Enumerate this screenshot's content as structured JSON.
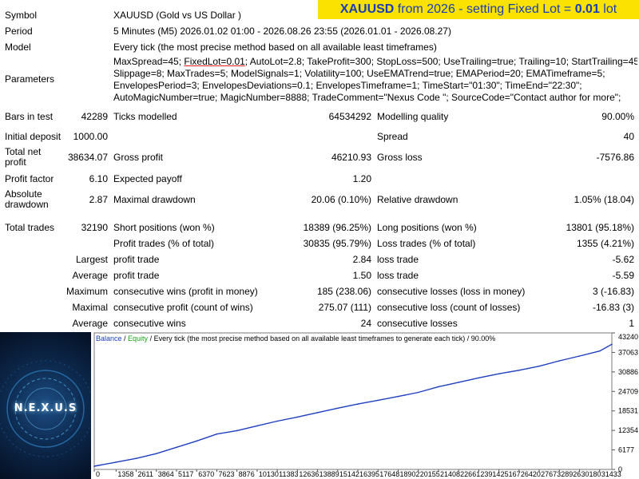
{
  "banner": {
    "symbol": "XAUUSD",
    "middle": "from 2026 - setting Fixed Lot =",
    "lot": "0.01",
    "unit": "lot"
  },
  "header_rows": [
    {
      "label": "Symbol",
      "value": "XAUUSD (Gold vs US Dollar )"
    },
    {
      "label": "Period",
      "value": "5 Minutes (M5) 2026.01.02 01:00 - 2026.08.26 23:55 (2026.01.01 - 2026.08.27)"
    },
    {
      "label": "Model",
      "value": "Every tick (the most precise method based on all available least timeframes)"
    }
  ],
  "parameters": {
    "label": "Parameters",
    "line1_pre": "MaxSpread=45;",
    "line1_fixed": "FixedLot=0.01",
    "line1_post": "; AutoLot=2.8; TakeProfit=300; StopLoss=500; UseTrailing=true; Trailing=10; StartTrailing=45;",
    "line2": "Slippage=8; MaxTrades=5; ModelSignals=1; Volatility=100; UseEMATrend=true; EMAPeriod=20; EMATimeframe=5;",
    "line3": "EnvelopesPeriod=3; EnvelopesDeviations=0.1; EnvelopesTimeframe=1; TimeStart=\"01:30\"; TimeEnd=\"22:30\";",
    "line4": "AutoMagicNumber=true; MagicNumber=8888; TradeComment=\"Nexus Code \"; SourceCode=\"Contact author for more\";"
  },
  "stats": {
    "bars_label": "Bars in test",
    "bars_value": "42289",
    "ticks_label": "Ticks modelled",
    "ticks_value": "64534292",
    "mq_label": "Modelling quality",
    "mq_value": "90.00%",
    "deposit_label": "Initial deposit",
    "deposit_value": "1000.00",
    "spread_label": "Spread",
    "spread_value": "40",
    "net_label": "Total net profit",
    "net_value": "38634.07",
    "gp_label": "Gross profit",
    "gp_value": "46210.93",
    "gl_label": "Gross loss",
    "gl_value": "-7576.86",
    "pf_label": "Profit factor",
    "pf_value": "6.10",
    "ep_label": "Expected payoff",
    "ep_value": "1.20",
    "ad_label": "Absolute drawdown",
    "ad_value": "2.87",
    "md_label": "Maximal drawdown",
    "md_value": "20.06 (0.10%)",
    "rd_label": "Relative drawdown",
    "rd_value": "1.05% (18.04)",
    "tt_label": "Total trades",
    "tt_value": "32190",
    "sp_label": "Short positions (won %)",
    "sp_value": "18389 (96.25%)",
    "lp_label": "Long positions (won %)",
    "lp_value": "13801 (95.18%)",
    "pt_label": "Profit trades (% of total)",
    "pt_value": "30835 (95.79%)",
    "lt_label": "Loss trades (% of total)",
    "lt_value": "1355 (4.21%)"
  },
  "detail_rows": [
    {
      "prefix": "Largest",
      "l1": "profit trade",
      "v1": "2.84",
      "l2": "loss trade",
      "v2": "-5.62"
    },
    {
      "prefix": "Average",
      "l1": "profit trade",
      "v1": "1.50",
      "l2": "loss trade",
      "v2": "-5.59"
    },
    {
      "prefix": "Maximum",
      "l1": "consecutive wins (profit in money)",
      "v1": "185 (238.06)",
      "l2": "consecutive losses (loss in money)",
      "v2": "3 (-16.83)"
    },
    {
      "prefix": "Maximal",
      "l1": "consecutive profit (count of wins)",
      "v1": "275.07 (111)",
      "l2": "consecutive loss (count of losses)",
      "v2": "-16.83 (3)"
    },
    {
      "prefix": "Average",
      "l1": "consecutive wins",
      "v1": "24",
      "l2": "consecutive losses",
      "v2": "1"
    }
  ],
  "logo": {
    "text": "N.E.X.U.S"
  },
  "colors": {
    "banner_bg": "#fbe200",
    "banner_text": "#1a3fb3",
    "balance": "#1f3fbf",
    "equity": "#1aa51a"
  },
  "chart_data": {
    "type": "line",
    "legend": {
      "balance": "Balance",
      "sep1": " / ",
      "equity": "Equity",
      "rest": " / Every tick (the most precise method based on all available least timeframes to generate each tick) / 90.00%"
    },
    "x_ticks": [
      "0",
      "1358",
      "2611",
      "3864",
      "5117",
      "6370",
      "7623",
      "8876",
      "10130",
      "11383",
      "12636",
      "13889",
      "15142",
      "16395",
      "17648",
      "18902",
      "20155",
      "21408",
      "22661",
      "23914",
      "25167",
      "26420",
      "27673",
      "28926",
      "30180",
      "31433"
    ],
    "y_ticks": [
      "43240",
      "37063",
      "30886",
      "24709",
      "18531",
      "12354",
      "6177",
      "0"
    ],
    "xlim": [
      0,
      32190
    ],
    "ylim": [
      0,
      43240
    ],
    "series": [
      {
        "name": "Balance",
        "x": [
          0,
          1358,
          2611,
          3864,
          5117,
          6370,
          7623,
          8876,
          10130,
          11383,
          12636,
          13889,
          15142,
          16395,
          17648,
          18902,
          20155,
          21408,
          22661,
          23914,
          25167,
          26420,
          27673,
          28926,
          30180,
          31433,
          32190
        ],
        "values": [
          1000,
          2300,
          3500,
          5000,
          7000,
          9000,
          11200,
          12300,
          13800,
          15300,
          16600,
          18000,
          19400,
          20700,
          21900,
          23100,
          24400,
          26200,
          27600,
          29000,
          30300,
          31400,
          32700,
          34400,
          35900,
          37500,
          39634
        ]
      }
    ]
  }
}
